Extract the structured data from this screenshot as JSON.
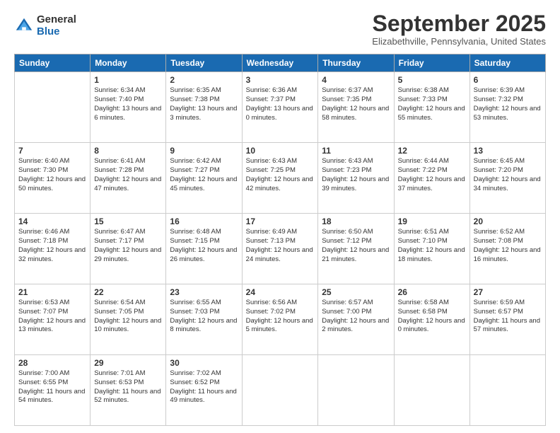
{
  "logo": {
    "general": "General",
    "blue": "Blue"
  },
  "header": {
    "month": "September 2025",
    "location": "Elizabethville, Pennsylvania, United States"
  },
  "days_of_week": [
    "Sunday",
    "Monday",
    "Tuesday",
    "Wednesday",
    "Thursday",
    "Friday",
    "Saturday"
  ],
  "weeks": [
    [
      {
        "day": "",
        "sunrise": "",
        "sunset": "",
        "daylight": ""
      },
      {
        "day": "1",
        "sunrise": "Sunrise: 6:34 AM",
        "sunset": "Sunset: 7:40 PM",
        "daylight": "Daylight: 13 hours and 6 minutes."
      },
      {
        "day": "2",
        "sunrise": "Sunrise: 6:35 AM",
        "sunset": "Sunset: 7:38 PM",
        "daylight": "Daylight: 13 hours and 3 minutes."
      },
      {
        "day": "3",
        "sunrise": "Sunrise: 6:36 AM",
        "sunset": "Sunset: 7:37 PM",
        "daylight": "Daylight: 13 hours and 0 minutes."
      },
      {
        "day": "4",
        "sunrise": "Sunrise: 6:37 AM",
        "sunset": "Sunset: 7:35 PM",
        "daylight": "Daylight: 12 hours and 58 minutes."
      },
      {
        "day": "5",
        "sunrise": "Sunrise: 6:38 AM",
        "sunset": "Sunset: 7:33 PM",
        "daylight": "Daylight: 12 hours and 55 minutes."
      },
      {
        "day": "6",
        "sunrise": "Sunrise: 6:39 AM",
        "sunset": "Sunset: 7:32 PM",
        "daylight": "Daylight: 12 hours and 53 minutes."
      }
    ],
    [
      {
        "day": "7",
        "sunrise": "Sunrise: 6:40 AM",
        "sunset": "Sunset: 7:30 PM",
        "daylight": "Daylight: 12 hours and 50 minutes."
      },
      {
        "day": "8",
        "sunrise": "Sunrise: 6:41 AM",
        "sunset": "Sunset: 7:28 PM",
        "daylight": "Daylight: 12 hours and 47 minutes."
      },
      {
        "day": "9",
        "sunrise": "Sunrise: 6:42 AM",
        "sunset": "Sunset: 7:27 PM",
        "daylight": "Daylight: 12 hours and 45 minutes."
      },
      {
        "day": "10",
        "sunrise": "Sunrise: 6:43 AM",
        "sunset": "Sunset: 7:25 PM",
        "daylight": "Daylight: 12 hours and 42 minutes."
      },
      {
        "day": "11",
        "sunrise": "Sunrise: 6:43 AM",
        "sunset": "Sunset: 7:23 PM",
        "daylight": "Daylight: 12 hours and 39 minutes."
      },
      {
        "day": "12",
        "sunrise": "Sunrise: 6:44 AM",
        "sunset": "Sunset: 7:22 PM",
        "daylight": "Daylight: 12 hours and 37 minutes."
      },
      {
        "day": "13",
        "sunrise": "Sunrise: 6:45 AM",
        "sunset": "Sunset: 7:20 PM",
        "daylight": "Daylight: 12 hours and 34 minutes."
      }
    ],
    [
      {
        "day": "14",
        "sunrise": "Sunrise: 6:46 AM",
        "sunset": "Sunset: 7:18 PM",
        "daylight": "Daylight: 12 hours and 32 minutes."
      },
      {
        "day": "15",
        "sunrise": "Sunrise: 6:47 AM",
        "sunset": "Sunset: 7:17 PM",
        "daylight": "Daylight: 12 hours and 29 minutes."
      },
      {
        "day": "16",
        "sunrise": "Sunrise: 6:48 AM",
        "sunset": "Sunset: 7:15 PM",
        "daylight": "Daylight: 12 hours and 26 minutes."
      },
      {
        "day": "17",
        "sunrise": "Sunrise: 6:49 AM",
        "sunset": "Sunset: 7:13 PM",
        "daylight": "Daylight: 12 hours and 24 minutes."
      },
      {
        "day": "18",
        "sunrise": "Sunrise: 6:50 AM",
        "sunset": "Sunset: 7:12 PM",
        "daylight": "Daylight: 12 hours and 21 minutes."
      },
      {
        "day": "19",
        "sunrise": "Sunrise: 6:51 AM",
        "sunset": "Sunset: 7:10 PM",
        "daylight": "Daylight: 12 hours and 18 minutes."
      },
      {
        "day": "20",
        "sunrise": "Sunrise: 6:52 AM",
        "sunset": "Sunset: 7:08 PM",
        "daylight": "Daylight: 12 hours and 16 minutes."
      }
    ],
    [
      {
        "day": "21",
        "sunrise": "Sunrise: 6:53 AM",
        "sunset": "Sunset: 7:07 PM",
        "daylight": "Daylight: 12 hours and 13 minutes."
      },
      {
        "day": "22",
        "sunrise": "Sunrise: 6:54 AM",
        "sunset": "Sunset: 7:05 PM",
        "daylight": "Daylight: 12 hours and 10 minutes."
      },
      {
        "day": "23",
        "sunrise": "Sunrise: 6:55 AM",
        "sunset": "Sunset: 7:03 PM",
        "daylight": "Daylight: 12 hours and 8 minutes."
      },
      {
        "day": "24",
        "sunrise": "Sunrise: 6:56 AM",
        "sunset": "Sunset: 7:02 PM",
        "daylight": "Daylight: 12 hours and 5 minutes."
      },
      {
        "day": "25",
        "sunrise": "Sunrise: 6:57 AM",
        "sunset": "Sunset: 7:00 PM",
        "daylight": "Daylight: 12 hours and 2 minutes."
      },
      {
        "day": "26",
        "sunrise": "Sunrise: 6:58 AM",
        "sunset": "Sunset: 6:58 PM",
        "daylight": "Daylight: 12 hours and 0 minutes."
      },
      {
        "day": "27",
        "sunrise": "Sunrise: 6:59 AM",
        "sunset": "Sunset: 6:57 PM",
        "daylight": "Daylight: 11 hours and 57 minutes."
      }
    ],
    [
      {
        "day": "28",
        "sunrise": "Sunrise: 7:00 AM",
        "sunset": "Sunset: 6:55 PM",
        "daylight": "Daylight: 11 hours and 54 minutes."
      },
      {
        "day": "29",
        "sunrise": "Sunrise: 7:01 AM",
        "sunset": "Sunset: 6:53 PM",
        "daylight": "Daylight: 11 hours and 52 minutes."
      },
      {
        "day": "30",
        "sunrise": "Sunrise: 7:02 AM",
        "sunset": "Sunset: 6:52 PM",
        "daylight": "Daylight: 11 hours and 49 minutes."
      },
      {
        "day": "",
        "sunrise": "",
        "sunset": "",
        "daylight": ""
      },
      {
        "day": "",
        "sunrise": "",
        "sunset": "",
        "daylight": ""
      },
      {
        "day": "",
        "sunrise": "",
        "sunset": "",
        "daylight": ""
      },
      {
        "day": "",
        "sunrise": "",
        "sunset": "",
        "daylight": ""
      }
    ]
  ]
}
